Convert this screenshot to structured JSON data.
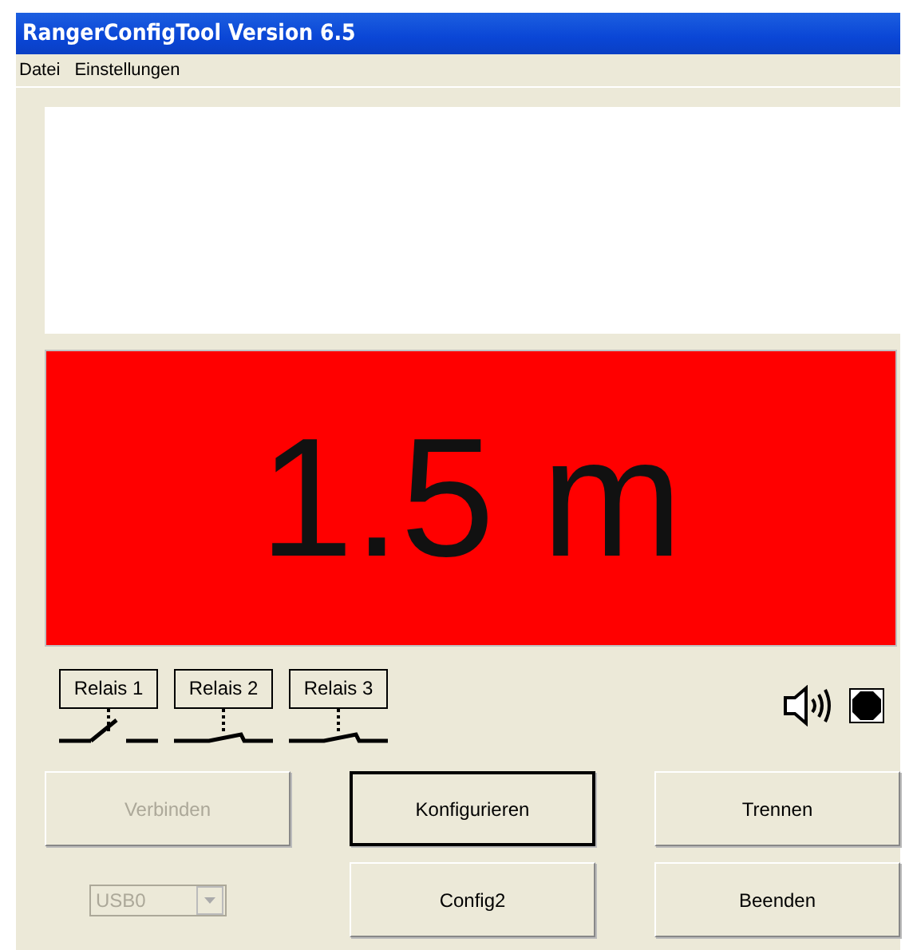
{
  "window": {
    "title": "RangerConfigTool Version 6.5"
  },
  "menu": [
    "Datei",
    "Einstellungen"
  ],
  "display": {
    "reading": "1.5 m"
  },
  "relays": [
    {
      "label": "Relais 1",
      "closed": false
    },
    {
      "label": "Relais 2",
      "closed": true
    },
    {
      "label": "Relais 3",
      "closed": true
    }
  ],
  "buttons": [
    {
      "label": "Verbinden",
      "disabled": true,
      "default": false
    },
    {
      "label": "Konfigurieren",
      "disabled": false,
      "default": true
    },
    {
      "label": "Trennen",
      "disabled": false,
      "default": false
    },
    {
      "label": "Config2",
      "disabled": false,
      "default": false
    },
    {
      "label": "Beenden",
      "disabled": false,
      "default": false
    }
  ],
  "port_select": {
    "value": "USB0",
    "disabled": true
  }
}
